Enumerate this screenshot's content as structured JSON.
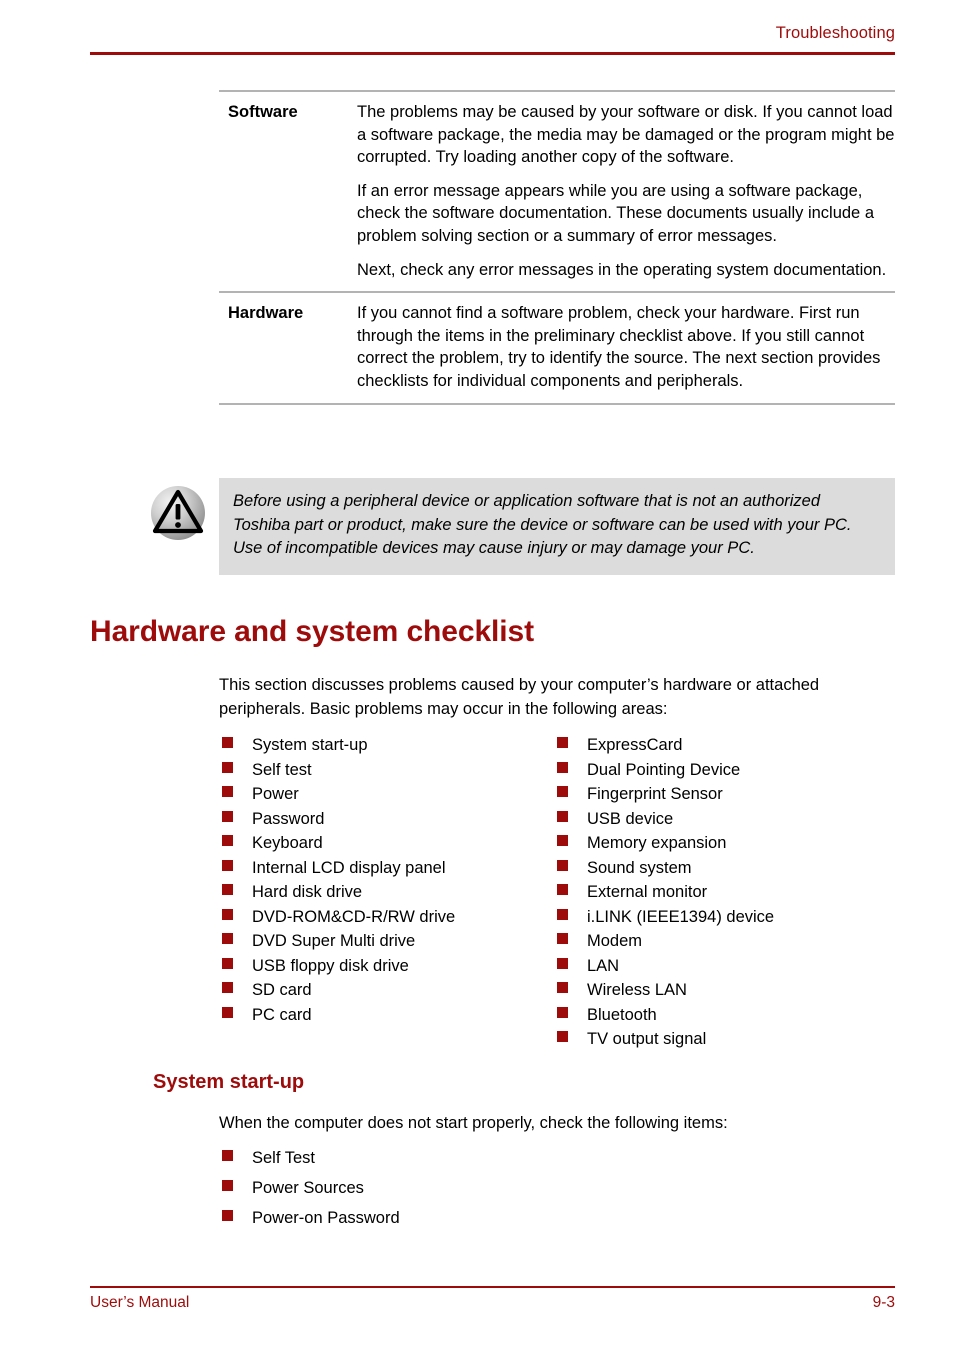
{
  "header": {
    "title": "Troubleshooting"
  },
  "definition_table": {
    "rows": [
      {
        "term": "Software",
        "paragraphs": [
          "The problems may be caused by your software or disk. If you cannot load a software package, the media may be damaged or the program might be corrupted. Try loading another copy of the software.",
          "If an error message appears while you are using a software package, check the software documentation. These documents usually include a problem solving section or a summary of error messages.",
          "Next, check any error messages in the operating system documentation."
        ]
      },
      {
        "term": "Hardware",
        "paragraphs": [
          "If you cannot find a software problem, check your hardware. First run through the items in the preliminary checklist above. If you still cannot correct the problem, try to identify the source. The next section provides checklists for individual components and peripherals."
        ]
      }
    ]
  },
  "caution": {
    "icon": "warning-triangle-icon",
    "text": "Before using a peripheral device or application software that is not an authorized Toshiba part or product, make sure the device or software can be used with your PC. Use of incompatible devices may cause injury or may damage your PC."
  },
  "section": {
    "heading": "Hardware and system checklist",
    "intro": "This section discusses problems caused by your computer’s hardware or attached peripherals. Basic problems may occur in the following areas:",
    "checklist_left": [
      "System start-up",
      "Self test",
      "Power",
      "Password",
      "Keyboard",
      "Internal LCD display panel",
      "Hard disk drive",
      "DVD-ROM&CD-R/RW drive",
      "DVD Super Multi drive",
      "USB floppy disk drive",
      "SD card",
      "PC card"
    ],
    "checklist_right": [
      "ExpressCard",
      "Dual Pointing Device",
      "Fingerprint Sensor",
      "USB device",
      "Memory expansion",
      "Sound system",
      "External monitor",
      "i.LINK (IEEE1394) device",
      "Modem",
      "LAN",
      "Wireless LAN",
      "Bluetooth",
      "TV output signal"
    ]
  },
  "subsection": {
    "heading": "System start-up",
    "intro": "When the computer does not start properly, check the following items:",
    "items": [
      "Self Test",
      "Power Sources",
      "Power-on Password"
    ]
  },
  "footer": {
    "left": "User’s Manual",
    "right": "9-3"
  },
  "colors": {
    "accent_red": "#9e0b0b",
    "rule_gray": "#b3b3b3",
    "caution_background": "#dcdcdc",
    "text_black": "#000000"
  }
}
